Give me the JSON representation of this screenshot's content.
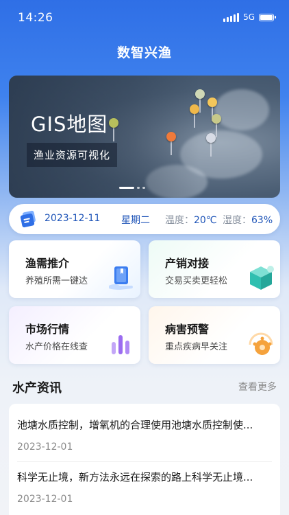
{
  "status": {
    "time": "14:26",
    "network": "5G"
  },
  "app": {
    "title": "数智兴渔"
  },
  "banner": {
    "heading": "GIS地图",
    "subtitle": "渔业资源可视化"
  },
  "info": {
    "date": "2023-12-11",
    "weekday": "星期二",
    "temp_label": "温度：",
    "temp_value": "20℃",
    "humidity_label": "湿度：",
    "humidity_value": "63%"
  },
  "services": [
    {
      "title": "渔需推介",
      "desc": "养殖所需一键达",
      "icon": "book-hand-icon",
      "color": "#3b7df0"
    },
    {
      "title": "产销对接",
      "desc": "交易买卖更轻松",
      "icon": "box-icon",
      "color": "#2fbfb0"
    },
    {
      "title": "市场行情",
      "desc": "水产价格在线查",
      "icon": "bar-chart-icon",
      "color": "#9b6cf0"
    },
    {
      "title": "病害预警",
      "desc": "重点疾病早关注",
      "icon": "virus-alert-icon",
      "color": "#f5a23c"
    }
  ],
  "news": {
    "section_title": "水产资讯",
    "more_label": "查看更多",
    "items": [
      {
        "title": "池塘水质控制，增氧机的合理使用池塘水质控制使...",
        "date": "2023-12-01"
      },
      {
        "title": "科学无止境，新方法永远在探索的路上科学无止境...",
        "date": "2023-12-01"
      }
    ]
  }
}
